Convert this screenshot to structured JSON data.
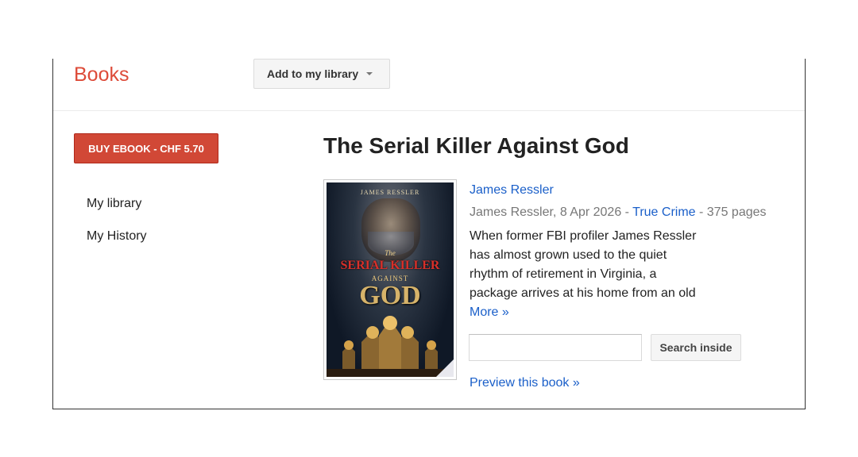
{
  "header": {
    "brand": "Books",
    "add_to_library_label": "Add to my library"
  },
  "sidebar": {
    "buy_button_label": "BUY EBOOK - CHF 5.70",
    "links": [
      "My library",
      "My History"
    ]
  },
  "book": {
    "title": "The Serial Killer Against God",
    "author": "James Ressler",
    "publisher_date": "James Ressler, 8 Apr 2026 - ",
    "genre": "True Crime",
    "pages": " - 375 pages",
    "description_lines": [
      "When former FBI profiler James Ressler",
      "has almost grown used to the quiet",
      "rhythm of retirement in Virginia, a",
      "package arrives at his home from an old"
    ],
    "more_label": "More »",
    "cover": {
      "author": "JAMES RESSLER",
      "line1": "The",
      "line2": "SERIAL KILLER",
      "line3": "AGAINST",
      "line4": "GOD"
    }
  },
  "search": {
    "value": "",
    "button_label": "Search inside"
  },
  "preview_label": "Preview this book »",
  "colors": {
    "brand": "#dd4b39",
    "buy_button": "#d14836",
    "link": "#1a5fc9"
  }
}
